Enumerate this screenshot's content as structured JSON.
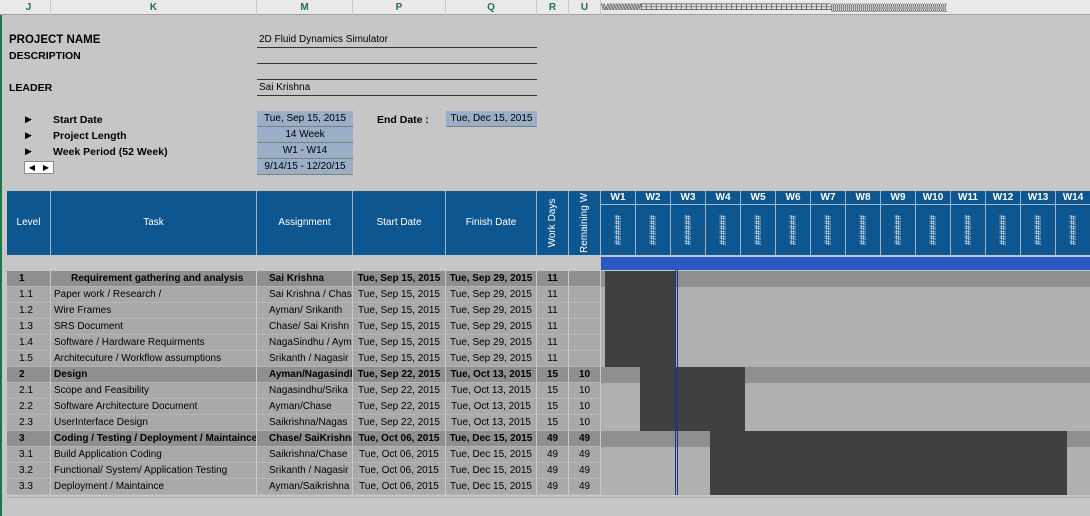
{
  "column_headers": [
    "J",
    "K",
    "M",
    "P",
    "Q",
    "R",
    "U"
  ],
  "column_header_overflow": "\\\\\\///////////////////////EEEEEEEEEEEEEEEEEEEEEEEEEEEEEEEEEEEEEE((((((((((((((((((((((((((((((((((((((((((((((((((((((((((",
  "project": {
    "name_label": "PROJECT NAME",
    "name_value": "2D Fluid Dynamics Simulator",
    "description_label": "DESCRIPTION",
    "leader_label": "LEADER",
    "leader_value": "Sai Krishna",
    "arrow": "▶",
    "start_date_label": "Start Date",
    "start_date_value": "Tue, Sep 15, 2015",
    "end_date_label": "End Date :",
    "end_date_value": "Tue, Dec 15, 2015",
    "length_label": "Project Length",
    "length_value": "14 Week",
    "week_period_label": "Week Period (52 Week)",
    "week_period_value": "W1 - W14",
    "date_range_value": "9/14/15 - 12/20/15",
    "spin_left": "◀",
    "spin_right": "▶"
  },
  "table_headers": {
    "level": "Level",
    "task": "Task",
    "assignment": "Assignment",
    "start": "Start Date",
    "finish": "Finish Date",
    "work_days": "Work Days",
    "remaining": "Remaining W"
  },
  "weeks": [
    "W1",
    "W2",
    "W3",
    "W4",
    "W5",
    "W6",
    "W7",
    "W8",
    "W9",
    "W10",
    "W11",
    "W12",
    "W13",
    "W14"
  ],
  "week_hash": "######",
  "rows": [
    {
      "level": "1",
      "task": "Requirement gathering and analysis",
      "assign": "Sai Krishna",
      "start": "Tue, Sep 15, 2015",
      "finish": "Tue, Sep 29, 2015",
      "work": "11",
      "remain": "",
      "type": "grp",
      "bar_start_week": 0.1,
      "bar_end_week": 2.1
    },
    {
      "level": "1.1",
      "task": "Paper work / Research /",
      "assign": "Sai Krishna / Chas",
      "start": "Tue, Sep 15, 2015",
      "finish": "Tue, Sep 29, 2015",
      "work": "11",
      "remain": "",
      "type": "sub",
      "bar_start_week": 0.1,
      "bar_end_week": 2.1
    },
    {
      "level": "1.2",
      "task": "Wire Frames",
      "assign": "Ayman/ Srikanth",
      "start": "Tue, Sep 15, 2015",
      "finish": "Tue, Sep 29, 2015",
      "work": "11",
      "remain": "",
      "type": "sub",
      "bar_start_week": 0.1,
      "bar_end_week": 2.1
    },
    {
      "level": "1.3",
      "task": "SRS Document",
      "assign": "Chase/ Sai Krishn",
      "start": "Tue, Sep 15, 2015",
      "finish": "Tue, Sep 29, 2015",
      "work": "11",
      "remain": "",
      "type": "sub",
      "bar_start_week": 0.1,
      "bar_end_week": 2.1
    },
    {
      "level": "1.4",
      "task": "Software / Hardware Requirments",
      "assign": "NagaSindhu / Aym",
      "start": "Tue, Sep 15, 2015",
      "finish": "Tue, Sep 29, 2015",
      "work": "11",
      "remain": "",
      "type": "sub",
      "bar_start_week": 0.1,
      "bar_end_week": 2.1
    },
    {
      "level": "1.5",
      "task": "Architecuture / Workflow assumptions",
      "assign": "Srikanth / Nagasir",
      "start": "Tue, Sep 15, 2015",
      "finish": "Tue, Sep 29, 2015",
      "work": "11",
      "remain": "",
      "type": "sub",
      "bar_start_week": 0.1,
      "bar_end_week": 2.1
    },
    {
      "level": "2",
      "task": "Design",
      "assign": "Ayman/Nagasindh",
      "start": "Tue, Sep 22, 2015",
      "finish": "Tue, Oct 13, 2015",
      "work": "15",
      "remain": "10",
      "type": "grp",
      "bar_start_week": 1.1,
      "bar_end_week": 4.1
    },
    {
      "level": "2.1",
      "task": "Scope and Feasibility",
      "assign": "Nagasindhu/Srika",
      "start": "Tue, Sep 22, 2015",
      "finish": "Tue, Oct 13, 2015",
      "work": "15",
      "remain": "10",
      "type": "sub",
      "bar_start_week": 1.1,
      "bar_end_week": 4.1
    },
    {
      "level": "2.2",
      "task": "Software Architecture Document",
      "assign": "Ayman/Chase",
      "start": "Tue, Sep 22, 2015",
      "finish": "Tue, Oct 13, 2015",
      "work": "15",
      "remain": "10",
      "type": "sub",
      "bar_start_week": 1.1,
      "bar_end_week": 4.1
    },
    {
      "level": "2.3",
      "task": "UserInterface Design",
      "assign": "Saikrishna/Nagas",
      "start": "Tue, Sep 22, 2015",
      "finish": "Tue, Oct 13, 2015",
      "work": "15",
      "remain": "10",
      "type": "sub",
      "bar_start_week": 1.1,
      "bar_end_week": 4.1
    },
    {
      "level": "3",
      "task": "Coding / Testing / Deployment / Maintaince",
      "assign": "Chase/ SaiKrishna",
      "start": "Tue, Oct 06, 2015",
      "finish": "Tue, Dec 15, 2015",
      "work": "49",
      "remain": "49",
      "type": "grp",
      "bar_start_week": 3.1,
      "bar_end_week": 13.3
    },
    {
      "level": "3.1",
      "task": "Build Application Coding",
      "assign": "Saikrishna/Chase",
      "start": "Tue, Oct 06, 2015",
      "finish": "Tue, Dec 15, 2015",
      "work": "49",
      "remain": "49",
      "type": "sub",
      "bar_start_week": 3.1,
      "bar_end_week": 13.3
    },
    {
      "level": "3.2",
      "task": "Functional/ System/ Application Testing",
      "assign": "Srikanth / Nagasir",
      "start": "Tue, Oct 06, 2015",
      "finish": "Tue, Dec 15, 2015",
      "work": "49",
      "remain": "49",
      "type": "sub",
      "bar_start_week": 3.1,
      "bar_end_week": 13.3
    },
    {
      "level": "3.3",
      "task": "Deployment / Maintaince",
      "assign": "Ayman/Saikrishna",
      "start": "Tue, Oct 06, 2015",
      "finish": "Tue, Dec 15, 2015",
      "work": "49",
      "remain": "49",
      "type": "sub",
      "bar_start_week": 3.1,
      "bar_end_week": 13.3
    }
  ],
  "colors": {
    "header_blue": "#0e5690",
    "bar_dark": "#404040",
    "today_line": "#1f2f8c",
    "timeline_strip": "#2b59c3",
    "date_field": "#9aaec7"
  }
}
